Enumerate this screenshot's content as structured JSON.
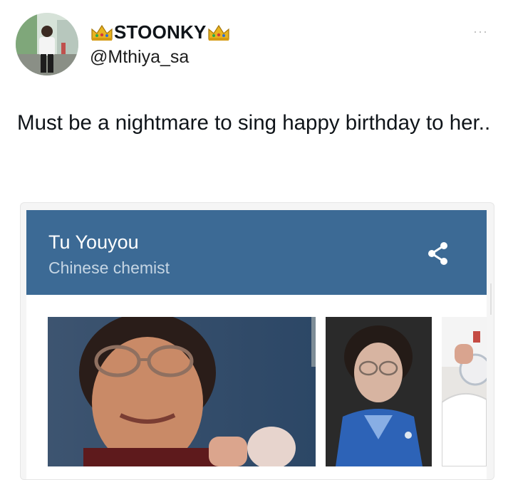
{
  "tweet": {
    "display_name": "STOONKY",
    "name_emoji": "crown-emoji",
    "handle": "@Mthiya_sa",
    "more_label": "···",
    "text": "Must be a nightmare to sing happy birthday to her.."
  },
  "card": {
    "title": "Tu Youyou",
    "subtitle": "Chinese chemist",
    "share_icon": "share-icon",
    "header_color": "#3c6a95",
    "images": [
      "portrait-image",
      "blue-suit-portrait-image",
      "lab-flask-image"
    ]
  }
}
